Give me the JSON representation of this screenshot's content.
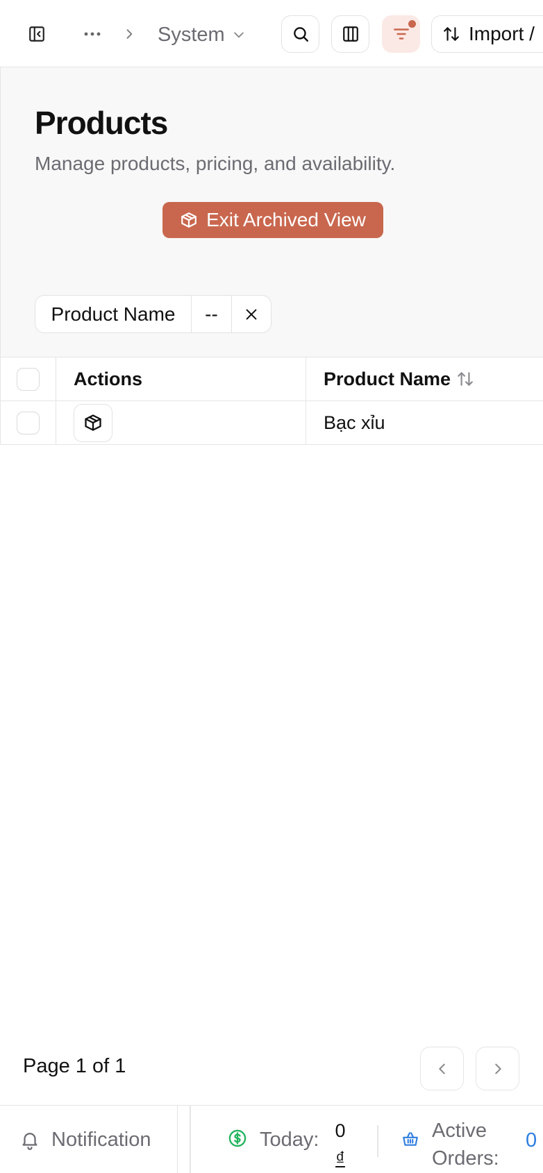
{
  "topbar": {
    "breadcrumb_current": "System",
    "import_label": "Import /"
  },
  "header": {
    "title": "Products",
    "subtitle": "Manage products, pricing, and availability.",
    "exit_archived_label": "Exit Archived View"
  },
  "filter_chip": {
    "field": "Product Name",
    "operator": "--"
  },
  "table": {
    "columns": [
      "Actions",
      "Product Name"
    ],
    "rows": [
      {
        "product_name": "Bạc xỉu"
      }
    ]
  },
  "pagination": {
    "label": "Page 1 of 1"
  },
  "footer": {
    "notification_label": "Notification",
    "today_label": "Today:",
    "today_amount": "0",
    "today_currency": "₫",
    "active_orders_label": "Active Orders:",
    "active_orders_value": "0"
  },
  "colors": {
    "accent": "#c9674e",
    "accent_soft": "#fbe9e5",
    "link_blue": "#2f7fe0",
    "money_green": "#22b35e"
  },
  "icons": [
    "sidebar-toggle-icon",
    "more-icon",
    "chevron-right-icon",
    "chevron-down-icon",
    "search-icon",
    "columns-icon",
    "filter-icon",
    "sort-icon",
    "archive-box-icon",
    "close-icon",
    "chevron-left-icon",
    "bell-icon",
    "dollar-circle-icon",
    "basket-icon"
  ]
}
